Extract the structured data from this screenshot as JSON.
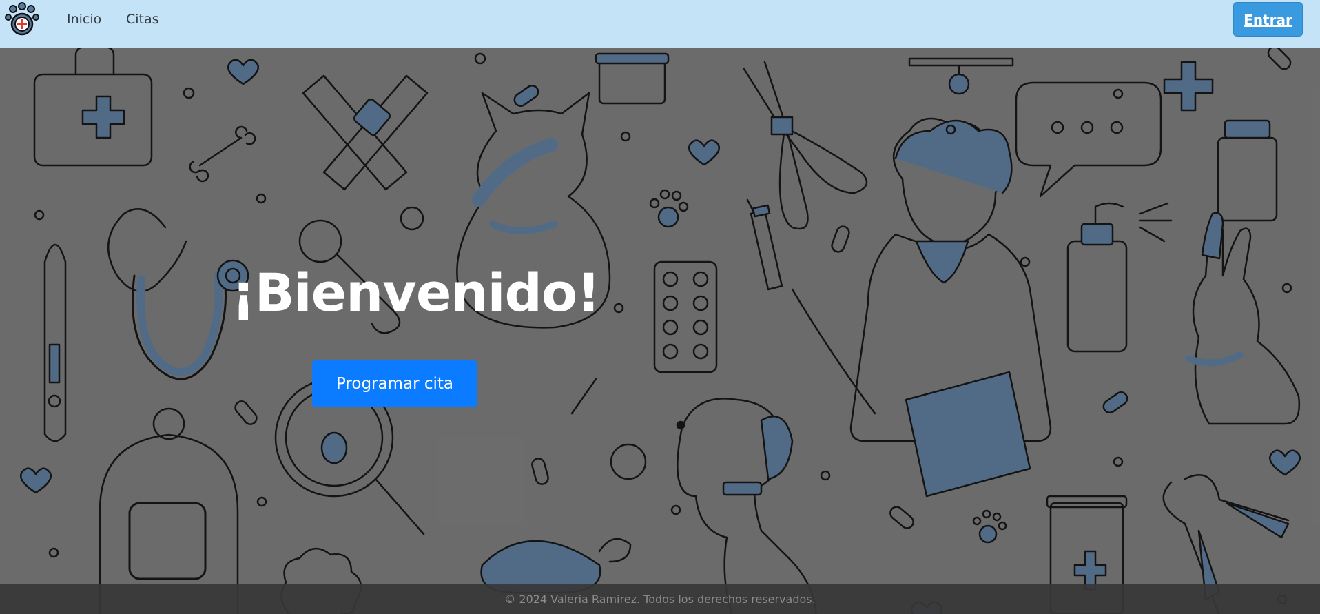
{
  "nav": {
    "logo_icon": "paw-medical-cross-icon",
    "links": [
      {
        "label": "Inicio"
      },
      {
        "label": "Citas"
      }
    ],
    "login_label": "Entrar"
  },
  "hero": {
    "title": "¡Bienvenido!",
    "cta_label": "Programar cita",
    "background": "veterinary-doodle-pattern"
  },
  "footer": {
    "text": "© 2024 Valeria Ramirez. Todos los derechos reservados."
  },
  "colors": {
    "navbar_bg": "#c5e3f6",
    "login_btn": "#3a9ae0",
    "cta_btn": "#0b7bff",
    "accent_blue": "#5b7a9d"
  }
}
